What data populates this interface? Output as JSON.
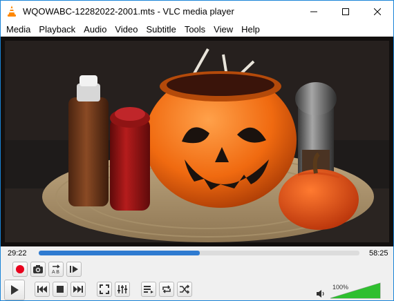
{
  "window": {
    "title": "WQOWABC-12282022-2001.mts - VLC media player"
  },
  "menu": {
    "items": [
      "Media",
      "Playback",
      "Audio",
      "Video",
      "Subtitle",
      "Tools",
      "View",
      "Help"
    ]
  },
  "player": {
    "elapsed": "29:22",
    "total": "58:25",
    "progress": 0.503,
    "volume_label": "100%",
    "volume_level": 1.0
  },
  "colors": {
    "accent": "#2f7bd1",
    "record": "#e8001c",
    "volume": "#2fbf2f"
  }
}
